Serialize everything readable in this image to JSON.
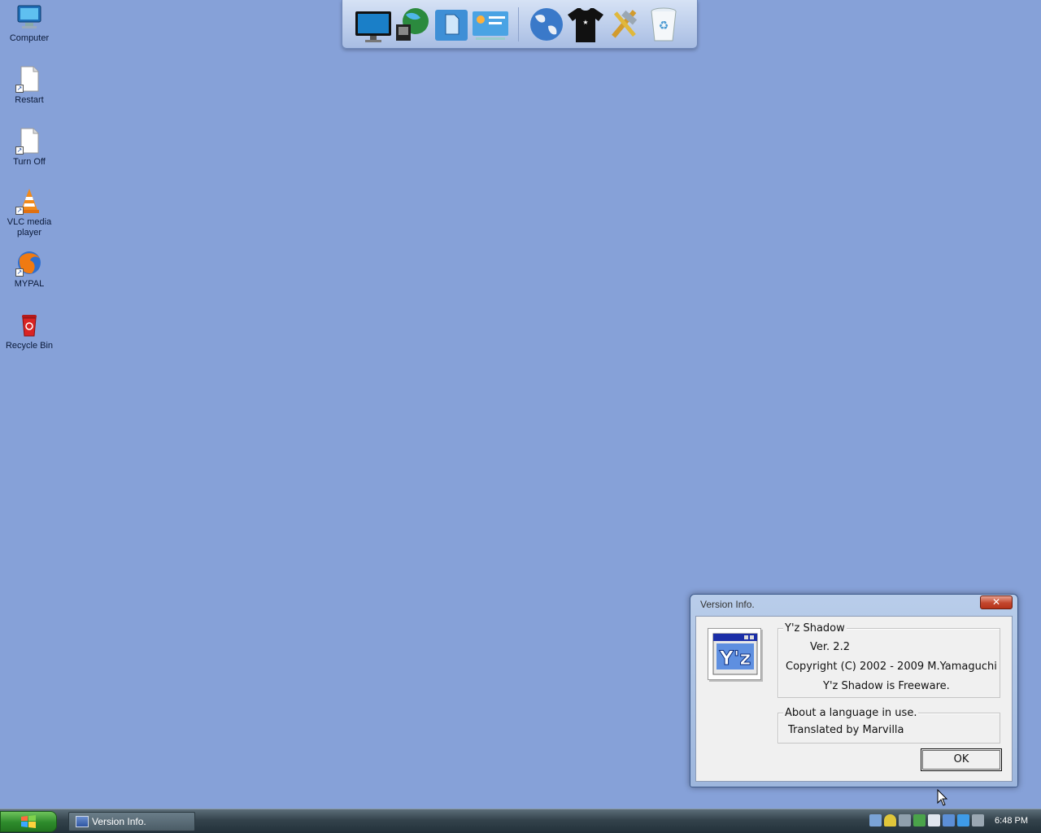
{
  "desktop": {
    "icons": [
      {
        "label": "Computer",
        "icon": "computer-icon"
      },
      {
        "label": "Restart",
        "icon": "shortcut-file-icon"
      },
      {
        "label": "Turn Off",
        "icon": "shortcut-file-icon"
      },
      {
        "label": "VLC media player",
        "icon": "vlc-icon"
      },
      {
        "label": "MYPAL",
        "icon": "mypal-browser-icon"
      },
      {
        "label": "Recycle Bin",
        "icon": "recycle-bin-icon"
      }
    ]
  },
  "dock": {
    "items": [
      "monitor-icon",
      "network-globe-icon",
      "documents-icon",
      "control-panel-icon",
      "internet-globe-icon",
      "tshirt-icon",
      "tools-icon",
      "trash-icon"
    ]
  },
  "dialog": {
    "title": "Version Info.",
    "close_label": "✕",
    "group1_legend": "Y'z Shadow",
    "version": "Ver.   2.2",
    "copyright": "Copyright (C) 2002 - 2009 M.Yamaguchi",
    "freeware": "Y'z Shadow is Freeware.",
    "group2_legend": "About a language in use.",
    "translated": "Translated by Marvilla",
    "ok_label": "OK",
    "logo_text": "Y'z"
  },
  "taskbar": {
    "task_label": "Version Info.",
    "clock": "6:48 PM"
  },
  "colors": {
    "desktop": "#86a1d8",
    "close": "#c3462d",
    "start": "#2d8a2b"
  }
}
